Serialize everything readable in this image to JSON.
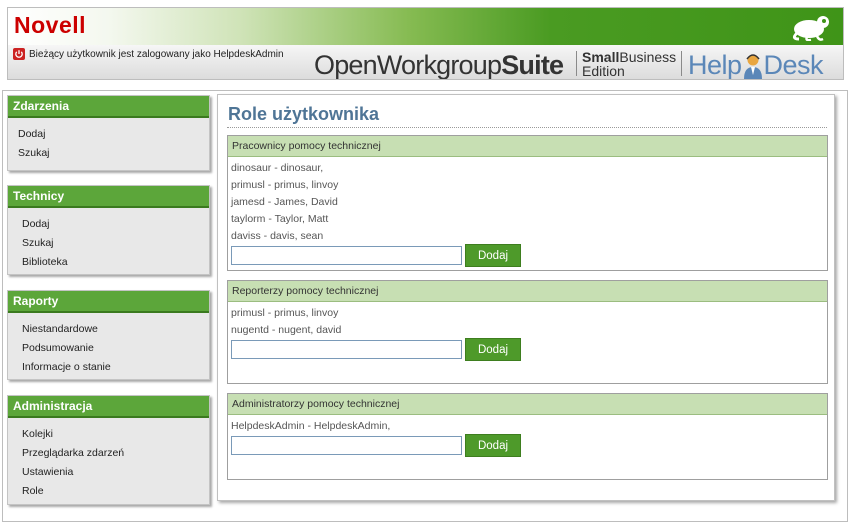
{
  "header": {
    "brand": "Novell",
    "user_status": "Bieżący użytkownik jest zalogowany jako HelpdeskAdmin",
    "suite_name_regular": "OpenWorkgroup",
    "suite_name_bold": "Suite",
    "edition_bold": "Small",
    "edition_regular": "Business",
    "edition_line2": "Edition",
    "product_part1": "Help",
    "product_part2": "Desk"
  },
  "sidebar": {
    "sections": [
      {
        "title": "Zdarzenia",
        "items": [
          "Dodaj",
          "Szukaj"
        ]
      },
      {
        "title": "Technicy",
        "items": [
          "Dodaj",
          "Szukaj",
          "Biblioteka"
        ]
      },
      {
        "title": "Raporty",
        "items": [
          "Niestandardowe",
          "Podsumowanie",
          "Informacje o stanie"
        ]
      },
      {
        "title": "Administracja",
        "items": [
          "Kolejki",
          "Przeglądarka zdarzeń",
          "Ustawienia",
          "Role"
        ]
      }
    ]
  },
  "main": {
    "title": "Role użytkownika",
    "groups": [
      {
        "title": "Pracownicy pomocy technicznej",
        "members": [
          "dinosaur - dinosaur,",
          "primusl - primus, linvoy",
          "jamesd - James, David",
          "taylorm - Taylor, Matt",
          "daviss - davis, sean"
        ],
        "input_value": "",
        "add_label": "Dodaj"
      },
      {
        "title": "Reporterzy pomocy technicznej",
        "members": [
          "primusl - primus, linvoy",
          "nugentd - nugent, david"
        ],
        "input_value": "",
        "add_label": "Dodaj"
      },
      {
        "title": "Administratorzy pomocy technicznej",
        "members": [
          "HelpdeskAdmin - HelpdeskAdmin,"
        ],
        "input_value": "",
        "add_label": "Dodaj"
      }
    ]
  },
  "colors": {
    "brand_red": "#cc0000",
    "menu_green": "#5ca63a",
    "button_green": "#4e9a2a",
    "group_header": "#c7dfb3",
    "title_blue": "#4f7596",
    "helpdesk_blue": "#5b87b8"
  },
  "icons": {
    "power": "power-icon",
    "gecko": "gecko-logo-icon",
    "helpdesk_figure": "helpdesk-agent-icon"
  }
}
